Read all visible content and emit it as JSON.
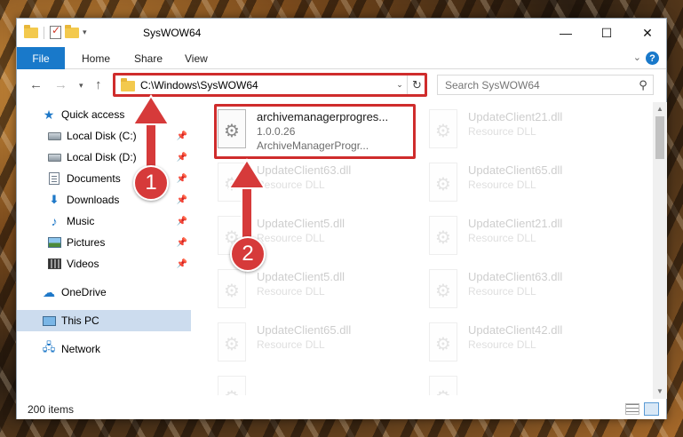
{
  "window": {
    "title": "SysWOW64",
    "minimize_glyph": "—",
    "maximize_glyph": "☐",
    "close_glyph": "✕"
  },
  "ribbon": {
    "tabs": [
      "File",
      "Home",
      "Share",
      "View"
    ]
  },
  "address": {
    "path": "C:\\Windows\\SysWOW64"
  },
  "search": {
    "placeholder": "Search SysWOW64"
  },
  "sidebar": {
    "items": [
      {
        "label": "Quick access",
        "icon": "star-icon"
      },
      {
        "label": "Local Disk (C:)",
        "icon": "disk-icon",
        "pinned": true
      },
      {
        "label": "Local Disk (D:)",
        "icon": "disk-icon",
        "pinned": true
      },
      {
        "label": "Documents",
        "icon": "document-icon",
        "pinned": true
      },
      {
        "label": "Downloads",
        "icon": "download-icon",
        "pinned": true
      },
      {
        "label": "Music",
        "icon": "music-icon",
        "pinned": true
      },
      {
        "label": "Pictures",
        "icon": "pictures-icon",
        "pinned": true
      },
      {
        "label": "Videos",
        "icon": "videos-icon",
        "pinned": true
      },
      {
        "label": "OneDrive",
        "icon": "cloud-icon"
      },
      {
        "label": "This PC",
        "icon": "computer-icon",
        "selected": true
      },
      {
        "label": "Network",
        "icon": "network-icon"
      }
    ]
  },
  "files": [
    {
      "name": "archivemanagerprogres...",
      "line2": "1.0.0.26",
      "line3": "ArchiveManagerProgr...",
      "highlighted": true
    },
    {
      "name": "UpdateClient21.dll",
      "line2": "Resource DLL"
    },
    {
      "name": "UpdateClient63.dll",
      "line2": "Resource DLL"
    },
    {
      "name": "UpdateClient65.dll",
      "line2": "Resource DLL"
    },
    {
      "name": "UpdateClient5.dll",
      "line2": "Resource DLL"
    },
    {
      "name": "UpdateClient21.dll",
      "line2": "Resource DLL"
    },
    {
      "name": "UpdateClient5.dll",
      "line2": "Resource DLL"
    },
    {
      "name": "UpdateClient63.dll",
      "line2": "Resource DLL"
    },
    {
      "name": "UpdateClient65.dll",
      "line2": "Resource DLL"
    },
    {
      "name": "UpdateClient42.dll",
      "line2": "Resource DLL"
    },
    {
      "name": "",
      "line2": ""
    },
    {
      "name": "",
      "line2": ""
    }
  ],
  "status": {
    "item_count": "200 items"
  },
  "callouts": [
    "1",
    "2"
  ],
  "colors": {
    "accent": "#1979ca",
    "highlight": "#cf2c2c",
    "selected_bg": "#ccdcee"
  }
}
